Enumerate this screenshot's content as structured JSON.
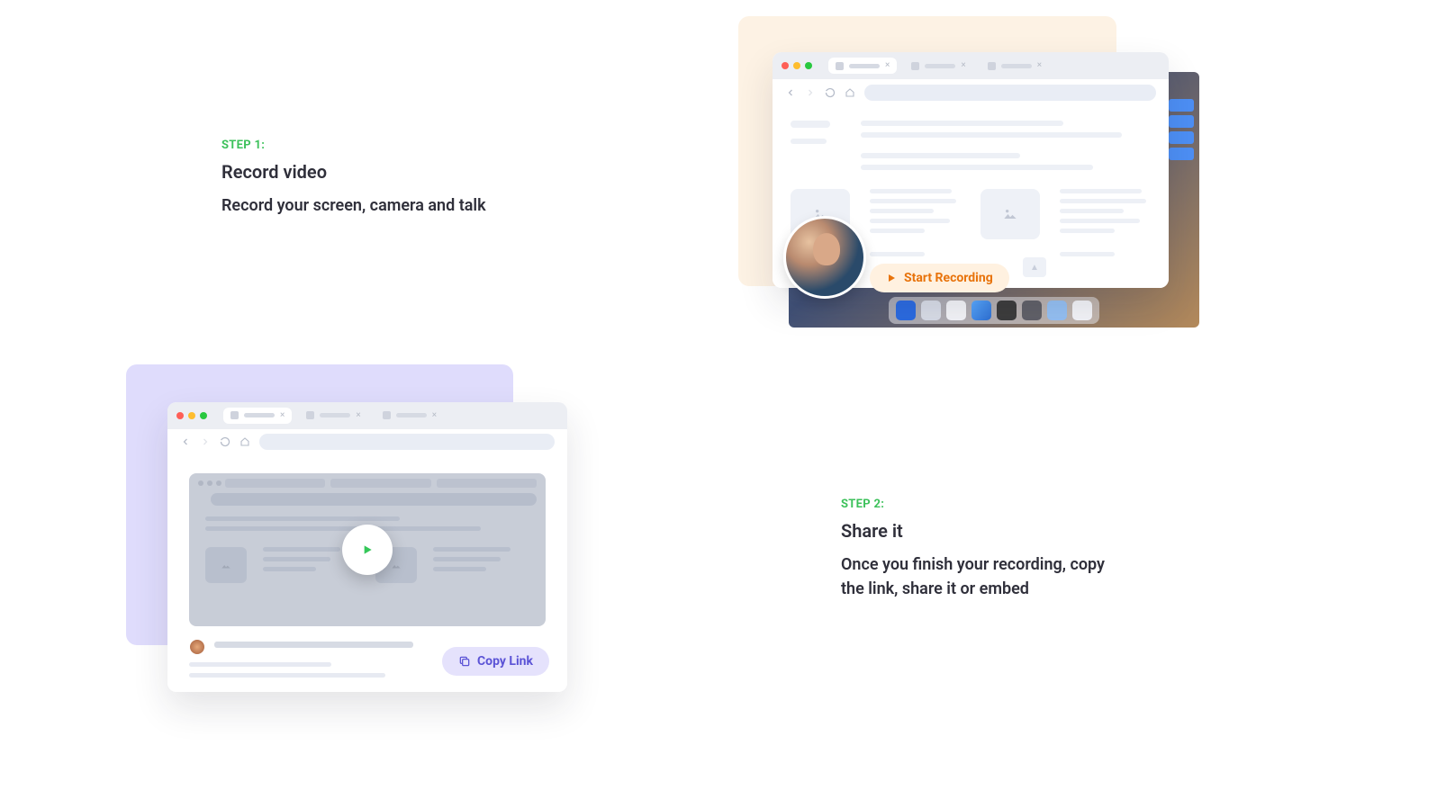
{
  "step1": {
    "label": "STEP 1:",
    "title": "Record video",
    "description": "Record your screen, camera and talk"
  },
  "step2": {
    "label": "STEP 2:",
    "title": "Share it",
    "description": "Once you finish your recording, copy the link, share it or embed"
  },
  "illustration1": {
    "start_recording_label": "Start Recording"
  },
  "illustration2": {
    "copy_link_label": "Copy Link"
  }
}
